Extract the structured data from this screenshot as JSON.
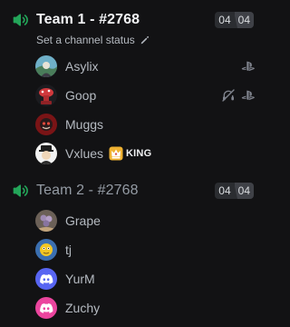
{
  "channels": [
    {
      "name": "Team 1 - #2768",
      "state": "active",
      "status_text": "Set a channel status",
      "user_count": "04",
      "user_limit": "04",
      "members": [
        {
          "name": "Asylix",
          "avatar": "asylix-avatar",
          "platform_icons": [
            "playstation-icon"
          ]
        },
        {
          "name": "Goop",
          "avatar": "goop-avatar",
          "platform_icons": [
            "deafened-icon",
            "playstation-icon"
          ]
        },
        {
          "name": "Muggs",
          "avatar": "muggs-avatar",
          "platform_icons": []
        },
        {
          "name": "Vxlues",
          "avatar": "vxlues-avatar",
          "platform_icons": [],
          "role_tag": "KING",
          "role_color": "#f0b232"
        }
      ]
    },
    {
      "name": "Team 2 - #2768",
      "state": "inactive",
      "user_count": "04",
      "user_limit": "04",
      "members": [
        {
          "name": "Grape",
          "avatar": "grape-avatar",
          "platform_icons": []
        },
        {
          "name": "tj",
          "avatar": "tj-avatar",
          "platform_icons": []
        },
        {
          "name": "YurM",
          "avatar": "discord-default-blurple-avatar",
          "platform_icons": []
        },
        {
          "name": "Zuchy",
          "avatar": "discord-default-pink-avatar",
          "platform_icons": []
        }
      ]
    }
  ],
  "colors": {
    "background": "#121214",
    "active_channel_text": "#f2f3f5",
    "inactive_channel_text": "#949ba4",
    "voice_icon": "#23a559",
    "username_text": "#b5bac1",
    "default_avatar_blurple": "#5865f2",
    "default_avatar_pink": "#eb459e"
  }
}
